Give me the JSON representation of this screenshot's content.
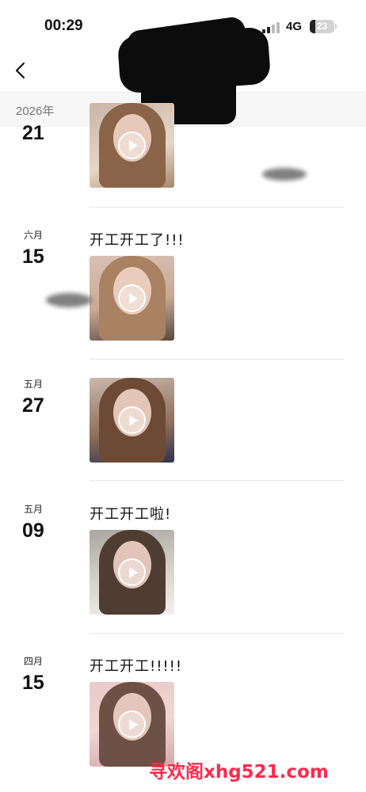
{
  "status_bar": {
    "time": "00:29",
    "network": "4G",
    "battery": "23"
  },
  "header": {
    "year": "2026年"
  },
  "posts": [
    {
      "month": "",
      "day": "21",
      "caption": ""
    },
    {
      "month": "六月",
      "day": "15",
      "caption": "开工开工了!!!"
    },
    {
      "month": "五月",
      "day": "27",
      "caption": ""
    },
    {
      "month": "五月",
      "day": "09",
      "caption": "开工开工啦!"
    },
    {
      "month": "四月",
      "day": "15",
      "caption": "开工开工!!!!!"
    }
  ],
  "icons": {
    "back": "chevron-left-icon",
    "play": "play-icon"
  },
  "colors": {
    "watermark": "#ff2a4a",
    "year_header_bg": "#f7f7f7"
  },
  "watermark": "寻欢阁xhg521.com"
}
